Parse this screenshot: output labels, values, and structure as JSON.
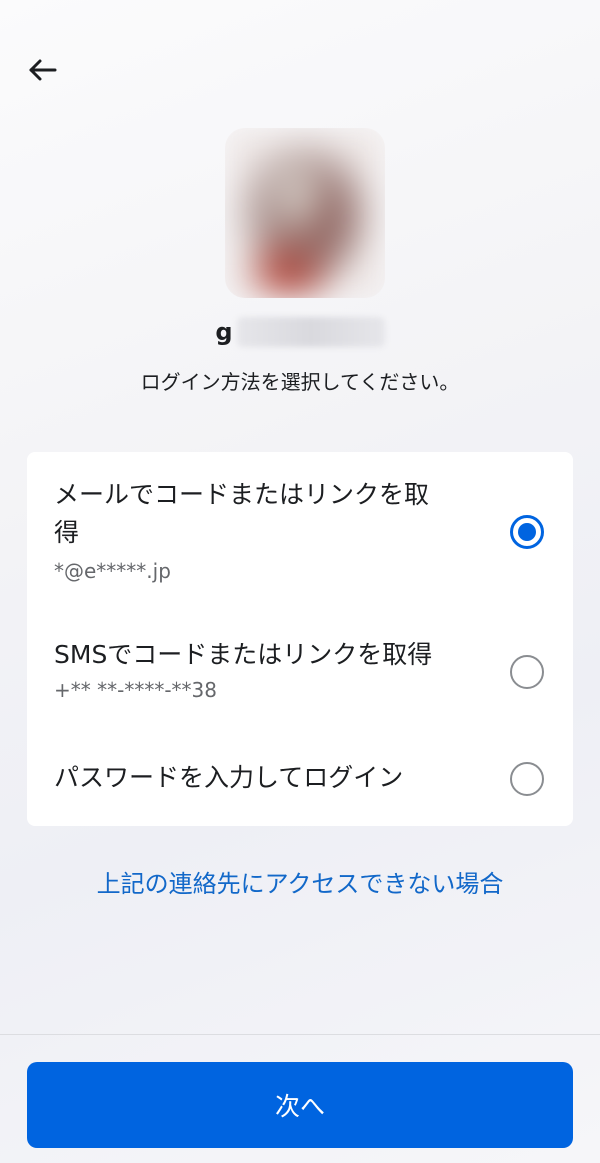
{
  "header": {
    "back_icon": "arrow-left-icon"
  },
  "profile": {
    "username_visible": "g",
    "username_masked": true
  },
  "subtitle": "ログイン方法を選択してください。",
  "options": [
    {
      "title_line1": "メールでコードまたはリンクを取",
      "title_line2": "得",
      "detail": "*@e*****.jp",
      "selected": true
    },
    {
      "title": "SMSでコードまたはリンクを取得",
      "detail": "+** **-****-**38",
      "selected": false
    },
    {
      "title": "パスワードを入力してログイン",
      "selected": false
    }
  ],
  "help_link": "上記の連絡先にアクセスできない場合",
  "next_button": "次へ",
  "colors": {
    "accent": "#0064e0",
    "link": "#1268c9",
    "card": "#ffffff",
    "text": "#1c1e21",
    "secondary_text": "#65676b"
  }
}
